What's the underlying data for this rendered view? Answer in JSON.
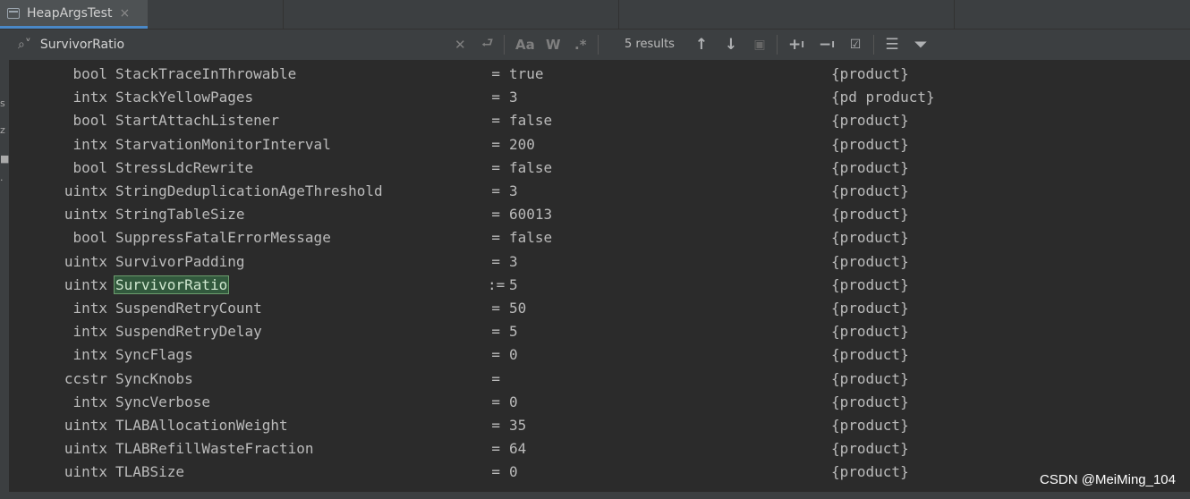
{
  "tab": {
    "title": "HeapArgsTest",
    "close": "×"
  },
  "search": {
    "query": "SurvivorRatio",
    "results": "5 results",
    "match_case": "Aa",
    "whole_words": "W",
    "regex": ".*"
  },
  "rows": [
    {
      "type": "bool",
      "name": "StackTraceInThrowable",
      "op": "=",
      "value": "true",
      "category": "{product}"
    },
    {
      "type": "intx",
      "name": "StackYellowPages",
      "op": "=",
      "value": "3",
      "category": "{pd product}"
    },
    {
      "type": "bool",
      "name": "StartAttachListener",
      "op": "=",
      "value": "false",
      "category": "{product}"
    },
    {
      "type": "intx",
      "name": "StarvationMonitorInterval",
      "op": "=",
      "value": "200",
      "category": "{product}"
    },
    {
      "type": "bool",
      "name": "StressLdcRewrite",
      "op": "=",
      "value": "false",
      "category": "{product}"
    },
    {
      "type": "uintx",
      "name": "StringDeduplicationAgeThreshold",
      "op": "=",
      "value": "3",
      "category": "{product}"
    },
    {
      "type": "uintx",
      "name": "StringTableSize",
      "op": "=",
      "value": "60013",
      "category": "{product}"
    },
    {
      "type": "bool",
      "name": "SuppressFatalErrorMessage",
      "op": "=",
      "value": "false",
      "category": "{product}"
    },
    {
      "type": "uintx",
      "name": "SurvivorPadding",
      "op": "=",
      "value": "3",
      "category": "{product}"
    },
    {
      "type": "uintx",
      "name": "SurvivorRatio",
      "op": ":=",
      "value": "5",
      "category": "{product}"
    },
    {
      "type": "intx",
      "name": "SuspendRetryCount",
      "op": "=",
      "value": "50",
      "category": "{product}"
    },
    {
      "type": "intx",
      "name": "SuspendRetryDelay",
      "op": "=",
      "value": "5",
      "category": "{product}"
    },
    {
      "type": "intx",
      "name": "SyncFlags",
      "op": "=",
      "value": "0",
      "category": "{product}"
    },
    {
      "type": "ccstr",
      "name": "SyncKnobs",
      "op": "=",
      "value": "",
      "category": "{product}"
    },
    {
      "type": "intx",
      "name": "SyncVerbose",
      "op": "=",
      "value": "0",
      "category": "{product}"
    },
    {
      "type": "uintx",
      "name": "TLABAllocationWeight",
      "op": "=",
      "value": "35",
      "category": "{product}"
    },
    {
      "type": "uintx",
      "name": "TLABRefillWasteFraction",
      "op": "=",
      "value": "64",
      "category": "{product}"
    },
    {
      "type": "uintx",
      "name": "TLABSize",
      "op": "=",
      "value": "0",
      "category": "{product}"
    }
  ],
  "highlight_row": 9,
  "gutter_glyphs": [
    "s",
    "z",
    "■",
    "·"
  ],
  "watermark": "CSDN @MeiMing_104",
  "colors": {
    "accent": "#4a88c7",
    "match_bg": "#32593d",
    "match_border": "#6c9d6e"
  }
}
